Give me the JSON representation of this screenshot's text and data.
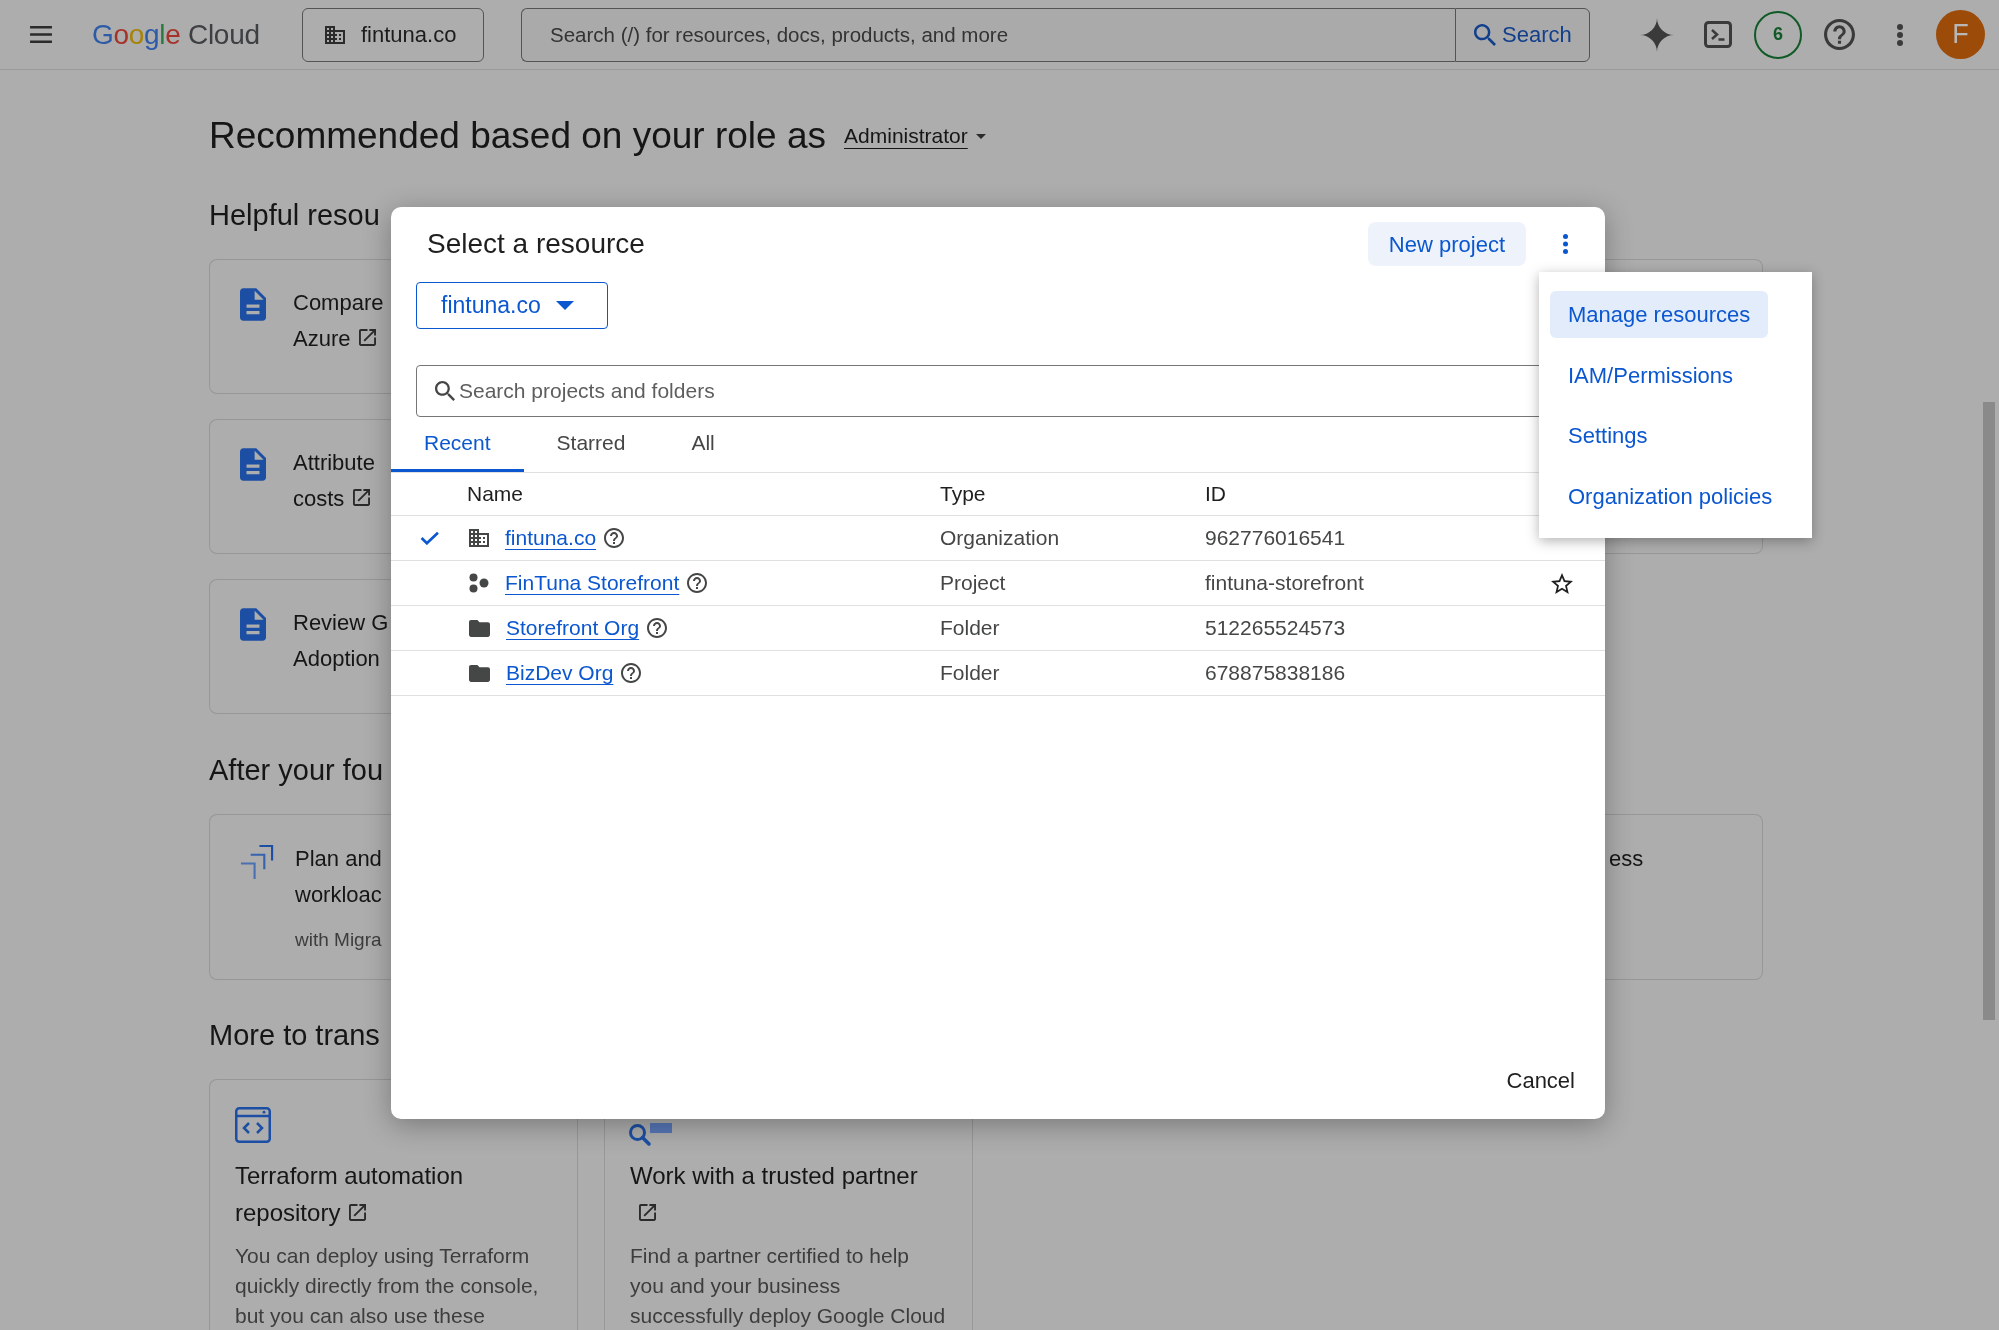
{
  "top_bar": {
    "logo": {
      "brand": "Google",
      "product": "Cloud"
    },
    "org_picker": "fintuna.co",
    "search": {
      "placeholder": "Search (/) for resources, docs, products, and more",
      "button": "Search"
    },
    "badge": "6",
    "avatar": "F"
  },
  "page": {
    "heading": "Recommended based on your role as",
    "role": "Administrator",
    "sections": [
      {
        "heading": "Helpful resou",
        "left_cards": [
          {
            "kind": "doc",
            "lines": [
              "Compare",
              "Azure"
            ],
            "external": true
          },
          {
            "kind": "doc",
            "lines": [
              "Attribute",
              "costs"
            ],
            "external": true
          },
          {
            "kind": "doc",
            "lines": [
              "Review G",
              "Adoption"
            ],
            "external": false
          }
        ],
        "right_cards": [
          {
            "kind": "blank"
          }
        ]
      },
      {
        "heading": "After your fou",
        "left_cards": [
          {
            "kind": "migrate",
            "lines": [
              "Plan and",
              "workloac"
            ],
            "note": "with Migra"
          }
        ],
        "right_cards": [
          {
            "kind": "text",
            "lines": [
              "ess"
            ]
          }
        ]
      },
      {
        "heading": "More to trans",
        "tiles": [
          {
            "kind": "code",
            "title": "Terraform automation repository",
            "external": true,
            "description": [
              "You can deploy using Terraform",
              "quickly directly from the console,",
              "but you can also use these"
            ]
          },
          {
            "kind": "partner",
            "title": "Work with a trusted partner",
            "external": true,
            "description": [
              "Find a partner certified to help",
              "you and your business",
              "successfully deploy Google Cloud"
            ]
          }
        ]
      }
    ]
  },
  "dialog": {
    "title": "Select a resource",
    "new_project": "New project",
    "scope": "fintuna.co",
    "search": {
      "placeholder": "Search projects and folders"
    },
    "tabs": [
      {
        "label": "Recent",
        "selected": true
      },
      {
        "label": "Starred",
        "selected": false
      },
      {
        "label": "All",
        "selected": false
      }
    ],
    "columns": [
      "Name",
      "Type",
      "ID"
    ],
    "rows": [
      {
        "kind": "organization",
        "name": "fintuna.co",
        "type": "Organization",
        "id": "962776016541",
        "selected": true
      },
      {
        "kind": "project",
        "name": "FinTuna Storefront",
        "type": "Project",
        "id": "fintuna-storefront",
        "selected": false,
        "starred": false
      },
      {
        "kind": "folder",
        "name": "Storefront Org",
        "type": "Folder",
        "id": "512265524573",
        "selected": false
      },
      {
        "kind": "folder",
        "name": "BizDev Org",
        "type": "Folder",
        "id": "678875838186",
        "selected": false
      }
    ],
    "cancel": "Cancel"
  },
  "menu": {
    "items": [
      {
        "label": "Manage resources",
        "highlighted": true
      },
      {
        "label": "IAM/Permissions",
        "highlighted": false
      },
      {
        "label": "Settings",
        "highlighted": false
      },
      {
        "label": "Organization policies",
        "highlighted": false
      }
    ]
  }
}
